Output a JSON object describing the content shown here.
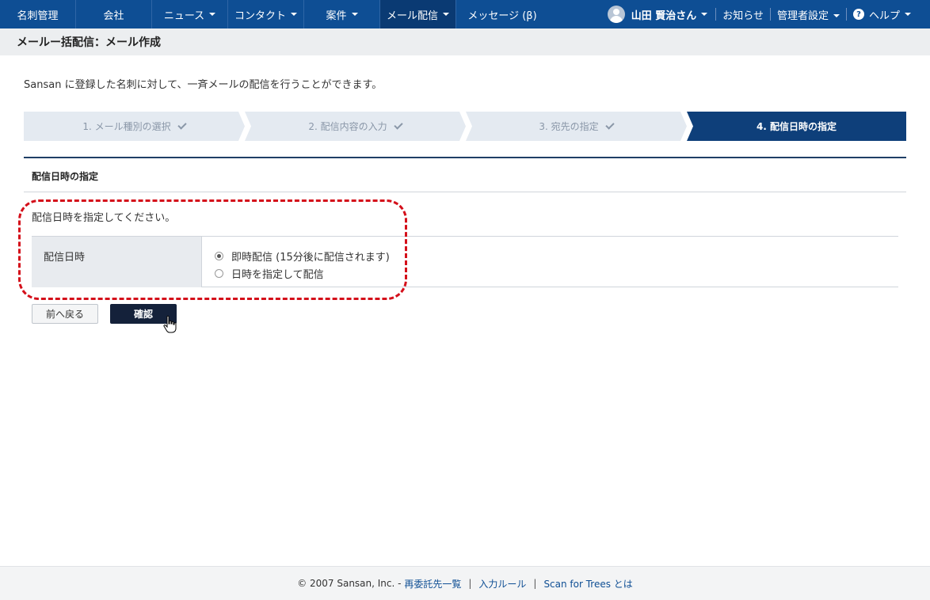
{
  "nav": {
    "items": [
      {
        "label": "名刺管理",
        "caret": false
      },
      {
        "label": "会社",
        "caret": false
      },
      {
        "label": "ニュース",
        "caret": true
      },
      {
        "label": "コンタクト",
        "caret": true
      },
      {
        "label": "案件",
        "caret": true
      },
      {
        "label": "メール配信",
        "caret": true
      },
      {
        "label": "メッセージ (β)",
        "caret": false
      }
    ],
    "active_index": 5,
    "user_name": "山田 賢治さん",
    "notice": "お知らせ",
    "admin": "管理者設定",
    "help": "ヘルプ"
  },
  "page": {
    "title": "メールー括配信：メール作成",
    "intro": "Sansan に登録した名刺に対して、一斉メールの配信を行うことができます。"
  },
  "steps": [
    {
      "label": "1. メール種別の選択",
      "done": true
    },
    {
      "label": "2. 配信内容の入力",
      "done": true
    },
    {
      "label": "3. 宛先の指定",
      "done": true
    },
    {
      "label": "4. 配信日時の指定",
      "done": false
    }
  ],
  "section": {
    "title": "配信日時の指定",
    "instruction": "配信日時を指定してください。",
    "field_label": "配信日時",
    "options": [
      {
        "label": "即時配信 (15分後に配信されます)",
        "checked": true
      },
      {
        "label": "日時を指定して配信",
        "checked": false
      }
    ]
  },
  "buttons": {
    "back": "前へ戻る",
    "confirm": "確認"
  },
  "footer": {
    "copyright": "© 2007 Sansan, Inc. -",
    "link1": "再委託先一覧",
    "link2": "入力ルール",
    "link3": "Scan for Trees とは",
    "separator": "|"
  }
}
